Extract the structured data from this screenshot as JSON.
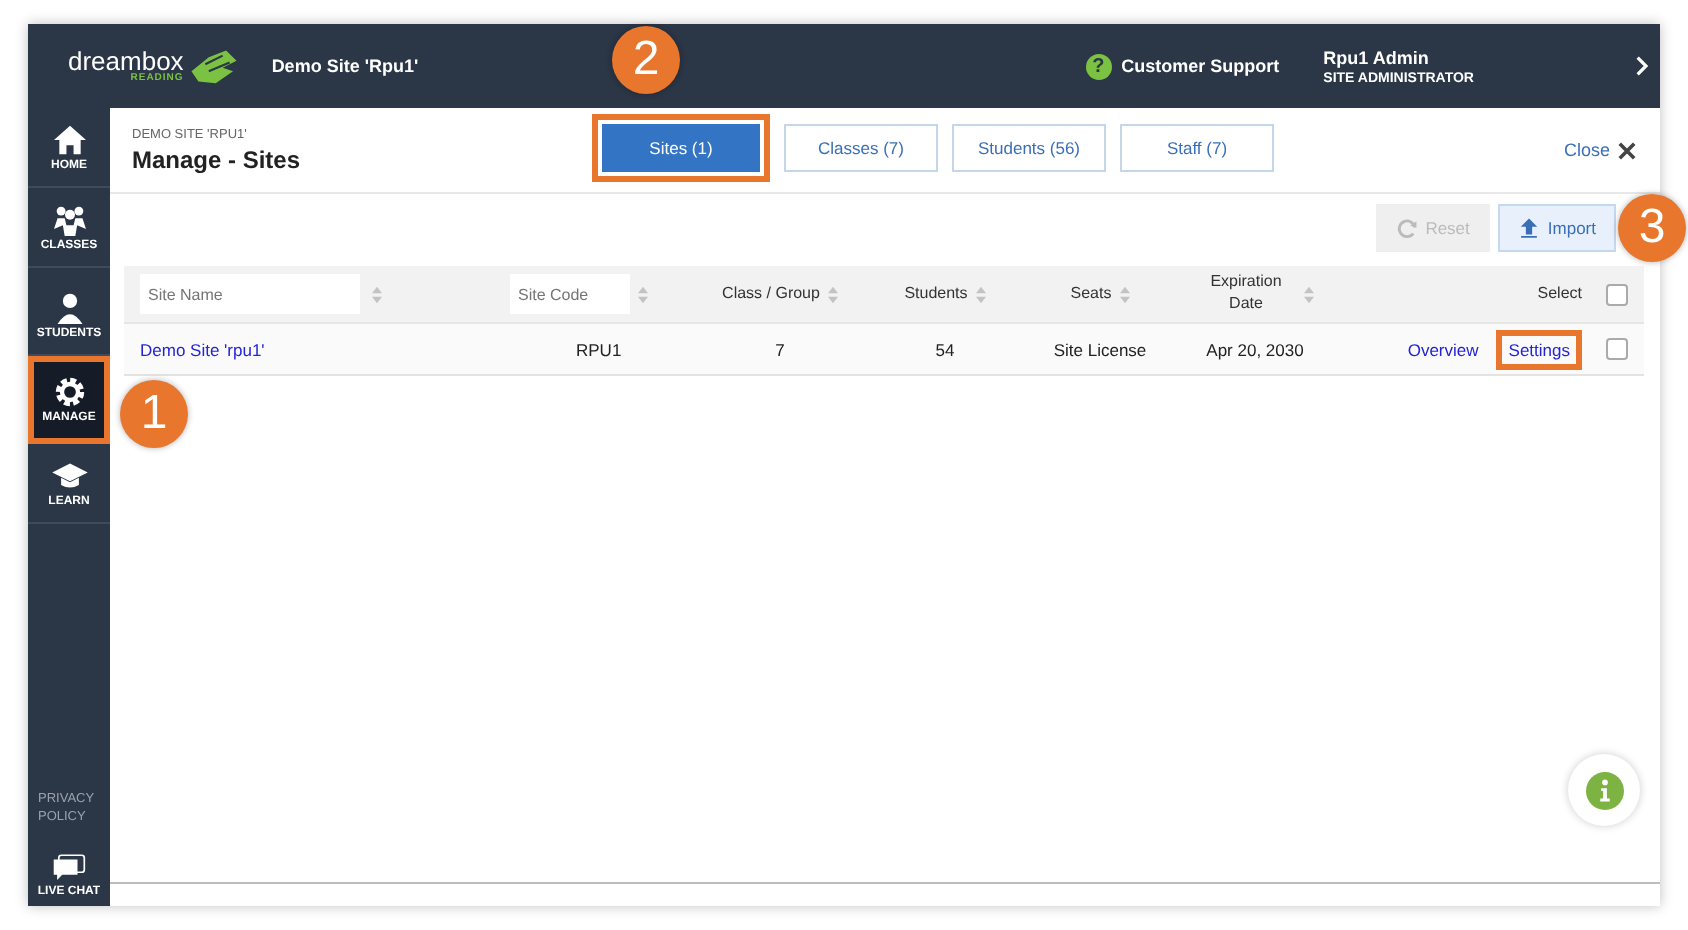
{
  "header": {
    "brand": "dreambox",
    "brand_sub": "READING",
    "site": "Demo Site 'Rpu1'",
    "help_icon": "?",
    "support": "Customer Support",
    "user": "Rpu1 Admin",
    "role": "SITE ADMINISTRATOR"
  },
  "sidebar": {
    "items": [
      {
        "label": "HOME",
        "selected": false,
        "highlighted": false
      },
      {
        "label": "CLASSES",
        "selected": false,
        "highlighted": false
      },
      {
        "label": "STUDENTS",
        "selected": false,
        "highlighted": false
      },
      {
        "label": "MANAGE",
        "selected": true,
        "highlighted": true
      },
      {
        "label": "LEARN",
        "selected": false,
        "highlighted": false
      }
    ],
    "privacy": "PRIVACY POLICY",
    "live_chat": "LIVE CHAT"
  },
  "page": {
    "breadcrumb": "DEMO SITE 'RPU1'",
    "title": "Manage - Sites",
    "close": "Close",
    "tabs": [
      {
        "label": "Sites (1)",
        "selected": true,
        "highlighted": true
      },
      {
        "label": "Classes (7)",
        "selected": false,
        "highlighted": false
      },
      {
        "label": "Students (56)",
        "selected": false,
        "highlighted": false
      },
      {
        "label": "Staff (7)",
        "selected": false,
        "highlighted": false
      }
    ]
  },
  "toolbar": [
    {
      "label": "Reset",
      "disabled": true
    },
    {
      "label": "Import",
      "disabled": false
    }
  ],
  "table": {
    "columns": [
      {
        "kind": "filter",
        "placeholder": "Site Name",
        "sortable": true
      },
      {
        "kind": "filter",
        "placeholder": "Site Code",
        "sortable": true
      },
      {
        "kind": "label",
        "label": "Class / Group",
        "sortable": true
      },
      {
        "kind": "label",
        "label": "Students",
        "sortable": true
      },
      {
        "kind": "label",
        "label": "Seats",
        "sortable": true
      },
      {
        "kind": "label",
        "label": "Expiration Date",
        "sortable": true
      },
      {
        "kind": "label",
        "label": "Select",
        "sortable": false
      },
      {
        "kind": "checkbox",
        "checked": false
      }
    ],
    "rows": [
      {
        "site_name": "Demo Site 'rpu1'",
        "site_code": "RPU1",
        "class_group": "7",
        "students": "54",
        "seats": "Site License",
        "expiration": "Apr 20, 2030",
        "actions": [
          {
            "label": "Overview",
            "highlighted": false
          },
          {
            "label": "Settings",
            "highlighted": true
          }
        ],
        "checked": false
      }
    ]
  },
  "callouts": [
    {
      "label": "1"
    },
    {
      "label": "2"
    },
    {
      "label": "3"
    }
  ]
}
